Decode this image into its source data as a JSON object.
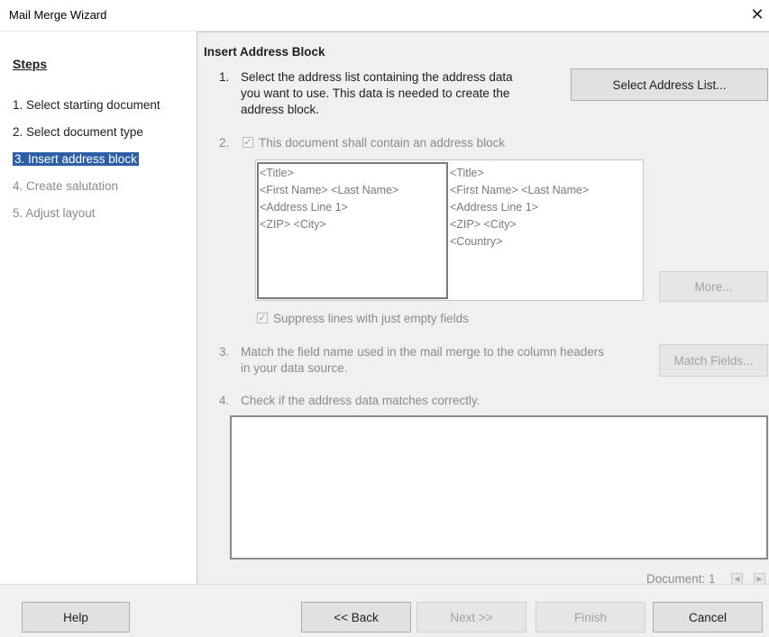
{
  "window": {
    "title": "Mail Merge Wizard",
    "close_icon": "close-icon"
  },
  "steps": {
    "title": "Steps",
    "items": [
      {
        "label": "1. Select starting document",
        "state": "done"
      },
      {
        "label": "2. Select document type",
        "state": "done"
      },
      {
        "label": "3. Insert address block",
        "state": "current"
      },
      {
        "label": "4. Create salutation",
        "state": "disabled"
      },
      {
        "label": "5. Adjust layout",
        "state": "disabled"
      }
    ]
  },
  "main": {
    "title": "Insert Address Block",
    "step1": {
      "number": "1.",
      "lines": [
        "Select the address list containing the address data",
        "you want to use. This data is needed to create the",
        "address block."
      ],
      "button": "Select Address List..."
    },
    "step2": {
      "number": "2.",
      "checkbox_label": "This document shall contain an address block",
      "checked": true,
      "address_block_1": [
        "<Title>",
        "<First Name> <Last Name>",
        "<Address Line 1>",
        "<ZIP> <City>"
      ],
      "address_block_2": [
        "<Title>",
        "<First Name> <Last Name>",
        "<Address Line 1>",
        "<ZIP> <City>",
        "<Country>"
      ],
      "more_button": "More...",
      "suppress_label": "Suppress lines with just empty fields",
      "suppress_checked": true
    },
    "step3": {
      "number": "3.",
      "lines": [
        "Match the field name used in the mail merge to the column headers",
        "in your data source."
      ],
      "button": "Match Fields..."
    },
    "step4": {
      "number": "4.",
      "text": "Check if the address data matches correctly."
    },
    "document_label": "Document: 1"
  },
  "footer": {
    "help": "Help",
    "back": "<< Back",
    "next": "Next >>",
    "finish": "Finish",
    "cancel": "Cancel"
  },
  "colors": {
    "selected_step_bg": "#2c5fa8",
    "panel_bg": "#f0f0f0",
    "disabled_text": "#8a8a8a"
  }
}
